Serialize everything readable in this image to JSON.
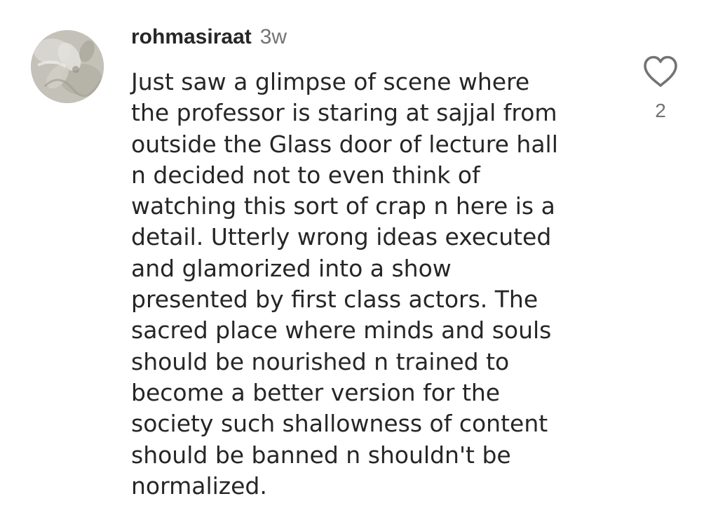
{
  "comment": {
    "username": "rohmasiraat",
    "time": "3w",
    "lines": [
      "Just saw  a glimpse of scene where",
      "the professor is staring at sajjal from",
      "outside the Glass door of lecture hall",
      "n decided not to even think of",
      "watching this sort of crap n here is a",
      "detail. Utterly wrong ideas executed",
      "and glamorized into a show",
      "presented by first class actors. The",
      "sacred place where minds and souls",
      "should be nourished n trained to",
      "become a better version for the",
      "society such shallowness of content",
      "should be banned n shouldn't be",
      "normalized."
    ],
    "like_count": "2",
    "like_icon": "heart-outline-icon",
    "avatar": "avatar-image"
  },
  "colors": {
    "text": "#262626",
    "secondary_text": "#737373",
    "background": "#ffffff"
  }
}
